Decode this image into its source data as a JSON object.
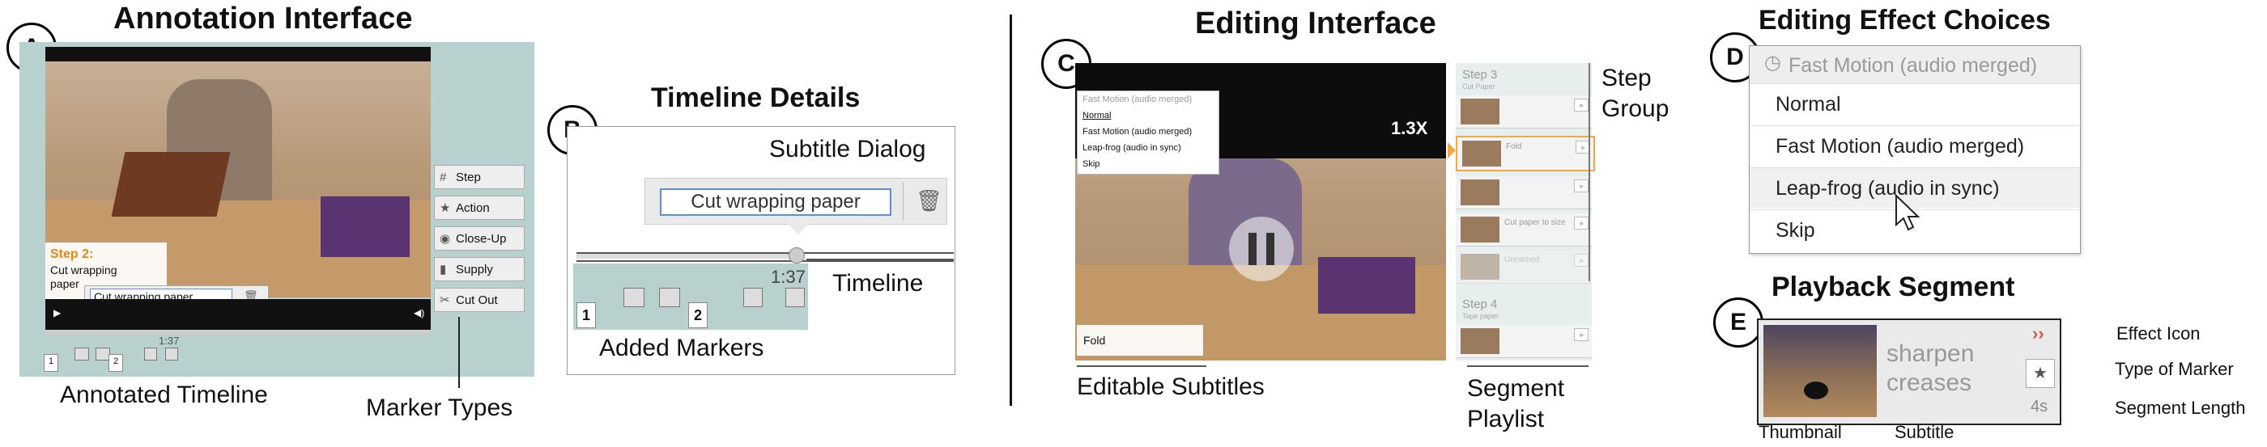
{
  "panel_a": {
    "letter": "A",
    "title": "Annotation Interface",
    "step_label": "Step 2:",
    "step_text": "Cut wrapping paper",
    "subtitle_input": "Cut wrapping paper",
    "timestamp": "1:37",
    "marker_labels": [
      "1",
      "2"
    ],
    "marker_types": [
      {
        "label": "Step",
        "icon": "#"
      },
      {
        "label": "Action",
        "icon": "★"
      },
      {
        "label": "Close-Up",
        "icon": "◉"
      },
      {
        "label": "Supply",
        "icon": "▮"
      },
      {
        "label": "Cut Out",
        "icon": "✂"
      }
    ],
    "caption_timeline": "Annotated Timeline",
    "caption_markers": "Marker Types"
  },
  "panel_b": {
    "letter": "B",
    "title": "Timeline Details",
    "subtitle_dialog": "Subtitle Dialog",
    "input_value": "Cut wrapping paper",
    "timestamp": "1:37",
    "timeline_label": "Timeline",
    "added_markers_label": "Added Markers",
    "marker_numbers": [
      "1",
      "2"
    ]
  },
  "panel_c": {
    "letter": "C",
    "title": "Editing Interface",
    "speed": "1.3X",
    "dropdown_header": "Fast Motion (audio merged)",
    "dropdown_items": [
      "Normal",
      "Fast Motion (audio merged)",
      "Leap-frog (audio in sync)",
      "Skip"
    ],
    "subtitle_text": "Fold",
    "playlist": {
      "step3_title": "Step 3",
      "step3_sub": "Cut Paper",
      "step4_title": "Step 4",
      "step4_sub": "Tape paper",
      "items": [
        "",
        "Fold",
        "",
        "Cut paper to size",
        "Unnamed"
      ]
    },
    "step_group_label": "Step Group",
    "editable_subtitles_label": "Editable Subtitles",
    "segment_playlist_label": "Segment Playlist"
  },
  "panel_d": {
    "letter": "D",
    "title": "Editing Effect Choices",
    "header": "Fast Motion (audio merged)",
    "options": [
      "Normal",
      "Fast Motion (audio merged)",
      "Leap-frog (audio in sync)",
      "Skip"
    ]
  },
  "panel_e": {
    "letter": "E",
    "title": "Playback Segment",
    "subtitle": "sharpen creases",
    "effect_glyph": "››",
    "marker_glyph": "★",
    "length": "4s",
    "labels": {
      "effect_icon": "Effect Icon",
      "type_of_marker": "Type of Marker",
      "segment_length": "Segment Length",
      "thumbnail": "Thumbnail",
      "subtitle": "Subtitle"
    }
  }
}
